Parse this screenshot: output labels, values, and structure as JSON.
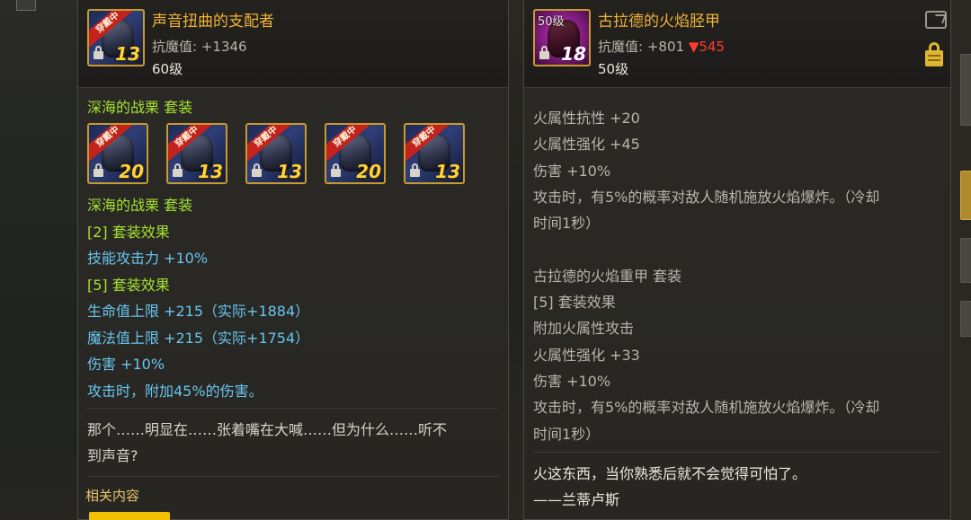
{
  "left_panel": {
    "item": {
      "name": "声音扭曲的支配者",
      "stat_label": "抗魔值: ",
      "stat_value": "+1346",
      "level": "60级",
      "wear_tag": "穿戴中",
      "enhance": "13"
    },
    "set_name": "深海的战栗  套装",
    "set_items": [
      {
        "wear_tag": "穿戴中",
        "enhance": "20"
      },
      {
        "wear_tag": "穿戴中",
        "enhance": "13"
      },
      {
        "wear_tag": "穿戴中",
        "enhance": "13"
      },
      {
        "wear_tag": "穿戴中",
        "enhance": "20"
      },
      {
        "wear_tag": "穿戴中",
        "enhance": "13"
      }
    ],
    "set_name_2": "深海的战栗  套装",
    "effect_2_header": "[2] 套装效果",
    "effect_2_line1": "技能攻击力 +10%",
    "effect_5_header": "[5] 套装效果",
    "effect_5_line1": "生命值上限 +215（实际+1884）",
    "effect_5_line2": "魔法值上限 +215（实际+1754）",
    "effect_5_line3": "伤害 +10%",
    "effect_5_line4": "攻击时，附加45%的伤害。",
    "flavor_line1": "那个……明显在……张着嘴在大喊……但为什么……听不",
    "flavor_line2": "到声音?",
    "related_label": "相关内容"
  },
  "right_panel": {
    "item": {
      "name": "古拉德的火焰胫甲",
      "stat_label": "抗魔值: ",
      "stat_value": "+801",
      "stat_diff": "▼545",
      "level": "50级",
      "icon_level": "50级",
      "enhance": "18"
    },
    "lines": [
      "火属性抗性 +20",
      "火属性强化 +45",
      "伤害 +10%",
      "攻击时，有5%的概率对敌人随机施放火焰爆炸。（冷却",
      "时间1秒）"
    ],
    "set_name": "古拉德的火焰重甲  套装",
    "set_effect_header": "[5] 套装效果",
    "set_lines": [
      "附加火属性攻击",
      "火属性强化 +33",
      "伤害 +10%",
      "攻击时，有5%的概率对敌人随机施放火焰爆炸。（冷却",
      "时间1秒）"
    ],
    "flavor_line1": "火这东西，当你熟悉后就不会觉得可怕了。",
    "flavor_line2": "——兰蒂卢斯"
  },
  "colors": {
    "title_gold": "#f0b233",
    "set_green": "#a6e22e",
    "effect_cyan": "#68c6f0",
    "stat_down_red": "#ff3a2f"
  }
}
